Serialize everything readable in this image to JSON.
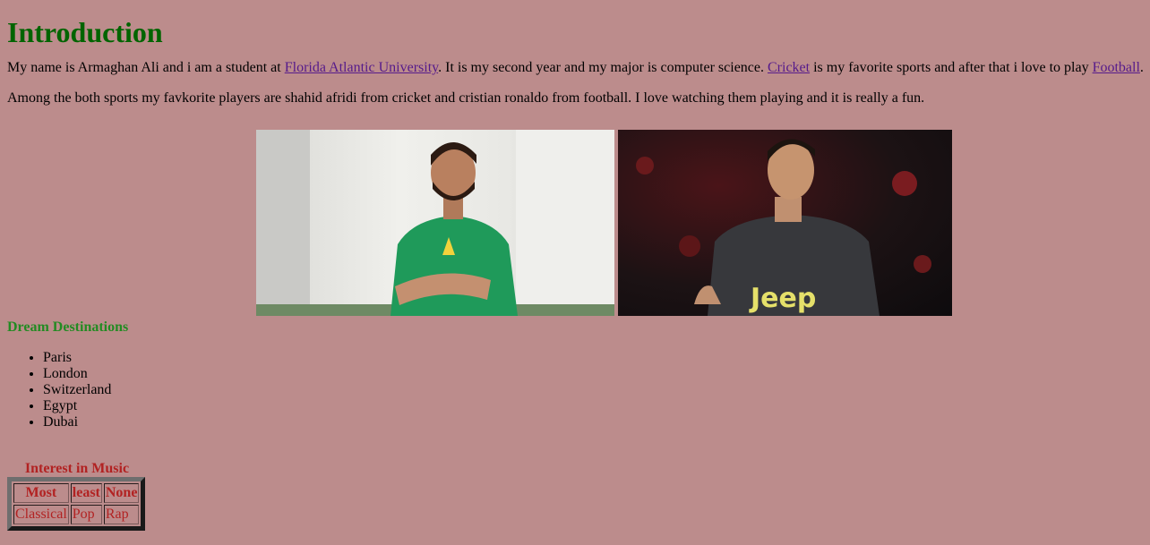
{
  "intro": {
    "heading": "Introduction",
    "p1_a": "My name is Armaghan Ali and i am a student at ",
    "link_fau": "Florida Atlantic University",
    "p1_b": ". It is my second year and my major is computer science. ",
    "link_cricket": "Cricket",
    "p1_c": " is my favorite sports and after that i love to play ",
    "link_football": "Football",
    "p1_d": ".",
    "p2": "Among the both sports my favkorite players are shahid afridi from cricket and cristian ronaldo from football. I love watching them playing and it is really a fun."
  },
  "photos": {
    "jersey_text": "Jeep"
  },
  "destinations": {
    "heading": "Dream Destinations",
    "items": [
      "Paris",
      "London",
      "Switzerland",
      "Egypt",
      "Dubai"
    ]
  },
  "music": {
    "caption": "Interest in Music",
    "headers": [
      "Most",
      "least",
      "None"
    ],
    "row": [
      "Classical",
      "Pop",
      "Rap"
    ]
  }
}
